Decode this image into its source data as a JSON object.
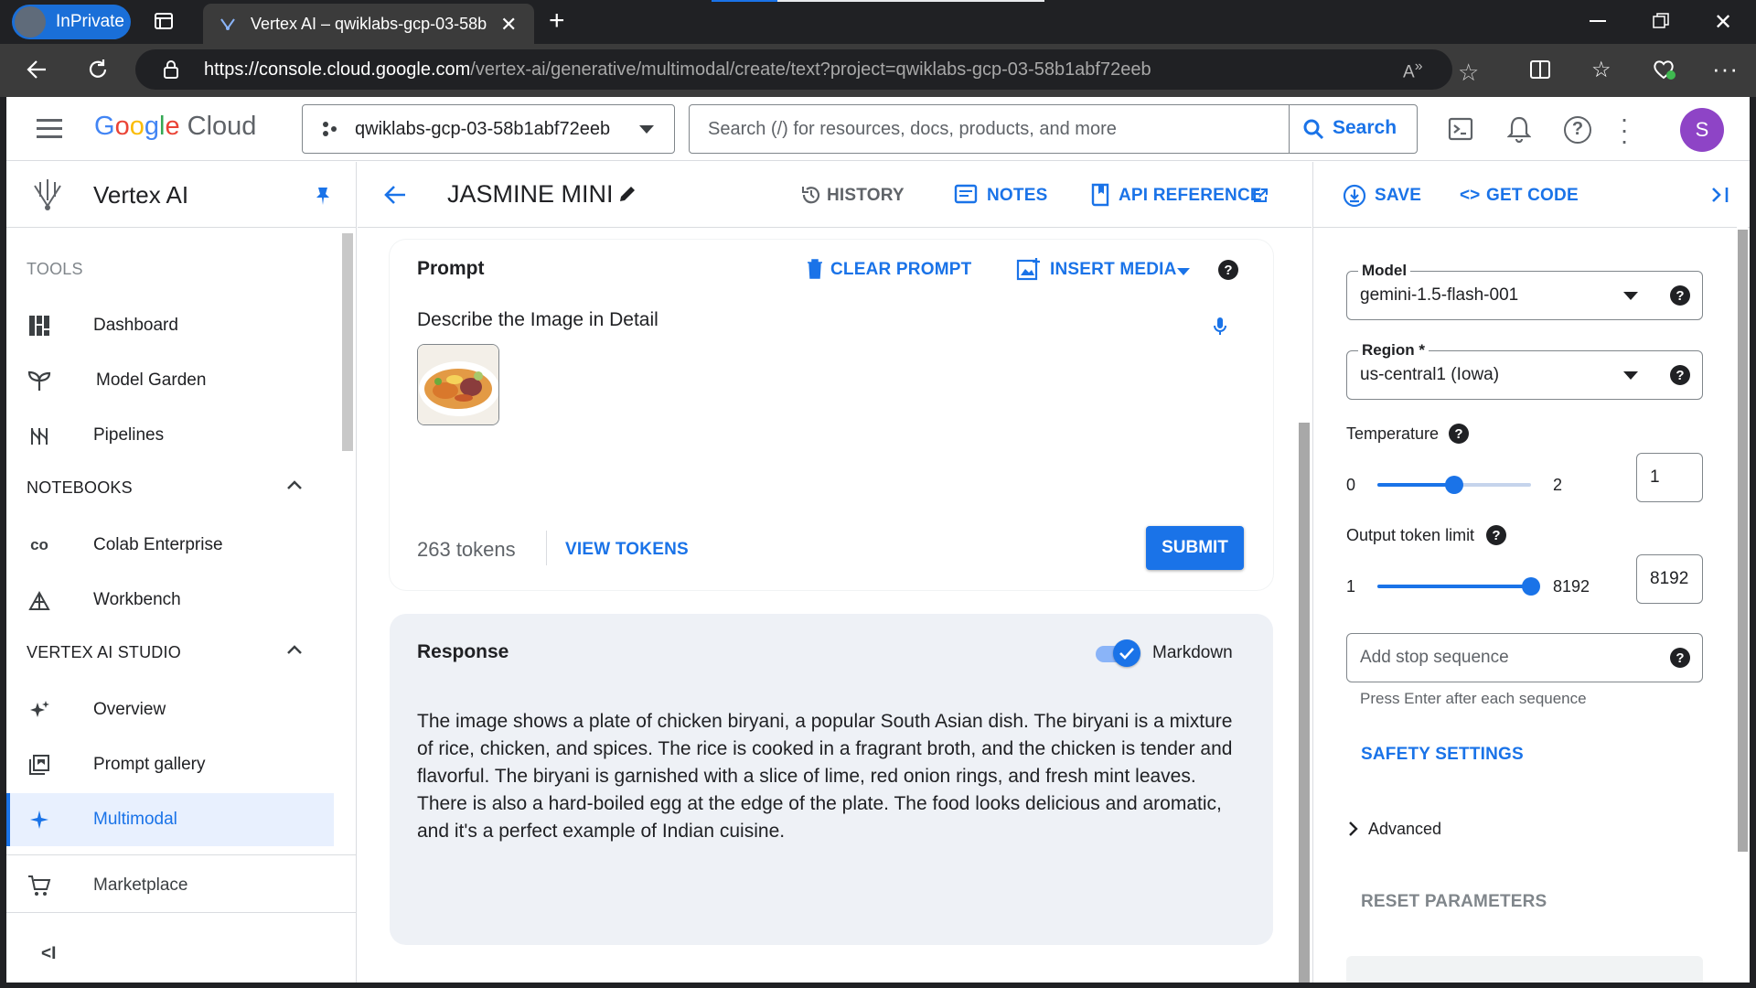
{
  "browser": {
    "inprivate_label": "InPrivate",
    "tab_title": "Vertex AI – qwiklabs-gcp-03-58b",
    "url_host": "https://console.cloud.google.com",
    "url_path": "/vertex-ai/generative/multimodal/create/text?project=qwiklabs-gcp-03-58b1abf72eeb"
  },
  "header": {
    "brand": "Google Cloud",
    "project": "qwiklabs-gcp-03-58b1abf72eeb",
    "search_placeholder": "Search (/) for resources, docs, products, and more",
    "search_button": "Search",
    "avatar_letter": "S"
  },
  "sidebar": {
    "title": "Vertex AI",
    "tools_heading": "TOOLS",
    "tools": [
      {
        "label": "Dashboard",
        "icon": "dashboard-icon"
      },
      {
        "label": "Model Garden",
        "icon": "model-garden-icon"
      },
      {
        "label": "Pipelines",
        "icon": "pipelines-icon"
      }
    ],
    "notebooks_heading": "NOTEBOOKS",
    "notebooks": [
      {
        "label": "Colab Enterprise",
        "icon": "colab-icon"
      },
      {
        "label": "Workbench",
        "icon": "workbench-icon"
      }
    ],
    "studio_heading": "VERTEX AI STUDIO",
    "studio": [
      {
        "label": "Overview",
        "icon": "sparkle-icon"
      },
      {
        "label": "Prompt gallery",
        "icon": "gallery-icon"
      },
      {
        "label": "Multimodal",
        "icon": "multimodal-icon",
        "active": true
      }
    ],
    "marketplace": "Marketplace"
  },
  "toolbar": {
    "prompt_name": "JASMINE MINI",
    "history": "HISTORY",
    "notes": "NOTES",
    "api_reference": "API REFERENCE"
  },
  "prompt": {
    "title": "Prompt",
    "clear": "CLEAR PROMPT",
    "insert_media": "INSERT MEDIA",
    "text": "Describe the Image in Detail",
    "tokens": "263 tokens",
    "view_tokens": "VIEW TOKENS",
    "submit": "SUBMIT"
  },
  "response": {
    "title": "Response",
    "markdown_label": "Markdown",
    "markdown_on": true,
    "text": "The image shows a plate of chicken biryani, a popular South Asian dish. The biryani is a mixture of rice, chicken, and spices. The rice is cooked in a fragrant broth, and the chicken is tender and flavorful. The biryani is garnished with a slice of lime, red onion rings, and fresh mint leaves. There is also a hard-boiled egg at the edge of the plate. The food looks delicious and aromatic, and it's a perfect example of Indian cuisine."
  },
  "right_panel": {
    "save": "SAVE",
    "get_code": "GET CODE",
    "model_label": "Model",
    "model_value": "gemini-1.5-flash-001",
    "region_label": "Region *",
    "region_value": "us-central1 (Iowa)",
    "temperature_label": "Temperature",
    "temperature_min": "0",
    "temperature_max": "2",
    "temperature_value": "1",
    "temperature_fraction": 0.5,
    "output_label": "Output token limit",
    "output_min": "1",
    "output_max": "8192",
    "output_value": "8192",
    "output_fraction": 1.0,
    "stop_placeholder": "Add stop sequence",
    "stop_hint": "Press Enter after each sequence",
    "safety": "SAFETY SETTINGS",
    "advanced": "Advanced",
    "reset": "RESET PARAMETERS"
  },
  "colors": {
    "accent": "#1a73e8",
    "active_bg": "#e8f0fe",
    "card_bg": "#f8f9fa",
    "response_bg": "#eef1f6"
  }
}
